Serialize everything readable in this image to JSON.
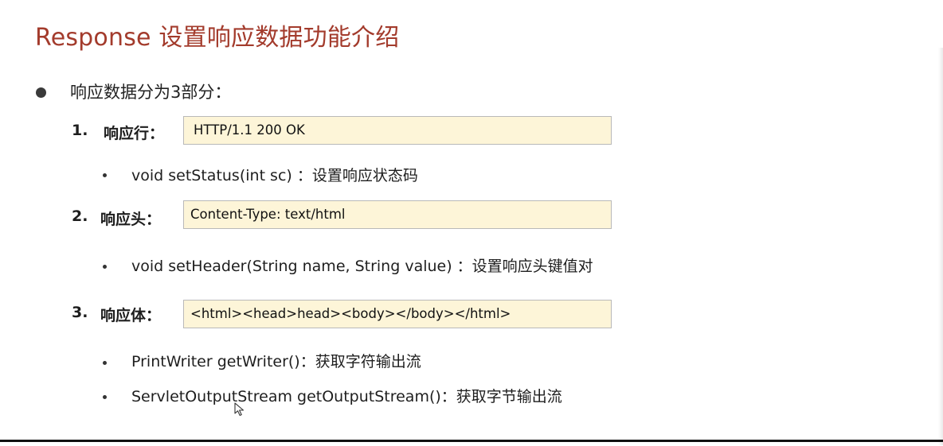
{
  "slide": {
    "title": "Response 设置响应数据功能介绍",
    "intro": "响应数据分为3部分：",
    "sections": [
      {
        "number": "1.",
        "label": "响应行：",
        "example": "HTTP/1.1 200 OK",
        "methods": [
          "void setStatus(int sc) ：设置响应状态码"
        ]
      },
      {
        "number": "2.",
        "label": "响应头：",
        "example": "Content-Type: text/html",
        "methods": [
          "void setHeader(String name, String value) ：设置响应头键值对"
        ]
      },
      {
        "number": "3.",
        "label": "响应体：",
        "example": "<html><head>head><body></body></html>",
        "methods": [
          "PrintWriter getWriter()：获取字符输出流",
          "ServletOutputStream getOutputStream()：获取字节输出流"
        ]
      }
    ]
  },
  "colors": {
    "title": "#a33b2c",
    "box_fill": "#fdf5d8",
    "box_border": "#b9b9b9"
  },
  "icons": {
    "cursor": "mouse-pointer-icon"
  }
}
